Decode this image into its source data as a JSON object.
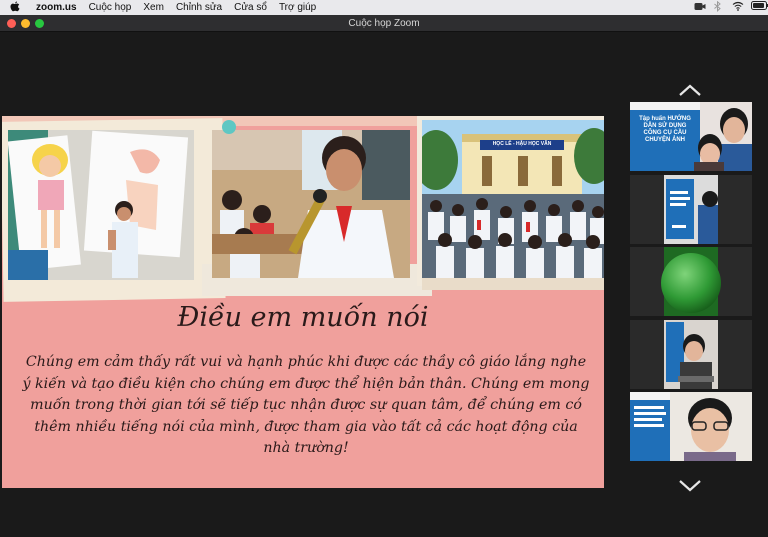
{
  "menubar": {
    "apple_icon": "apple-logo",
    "app_name": "zoom.us",
    "items": [
      "Cuộc họp",
      "Xem",
      "Chỉnh sửa",
      "Cửa sổ",
      "Trợ giúp"
    ]
  },
  "window": {
    "title": "Cuộc họp Zoom"
  },
  "slide": {
    "heading": "Điều em muốn nói",
    "paragraph": "Chúng em cảm thấy rất vui và hạnh phúc khi được các thầy cô giáo lắng nghe ý kiến và tạo điều kiện cho chúng em được thể hiện bản thân. Chúng em mong muốn trong thời gian tới sẽ tiếp tục nhận được sự quan tâm, để chúng em có thêm nhiều tiếng nói của mình, được tham gia vào tất cả các hoạt động của nhà trường!",
    "photo3_sign": "HỌC LỄ - HẬU HỌC VĂN"
  },
  "thumbnails": [
    {
      "type": "shared-slide-with-person",
      "slide_text": "Tập huấn HƯỚNG DẪN SỬ DỤNG CÔNG CỤ CẦU CHUYỆN ẢNH"
    },
    {
      "type": "shared-slide-with-person"
    },
    {
      "type": "green-circle"
    },
    {
      "type": "shared-slide-with-person"
    },
    {
      "type": "shared-slide-with-person"
    }
  ],
  "colors": {
    "slide_bg": "#f0a09c",
    "dark_bg": "#1a1a1a"
  }
}
